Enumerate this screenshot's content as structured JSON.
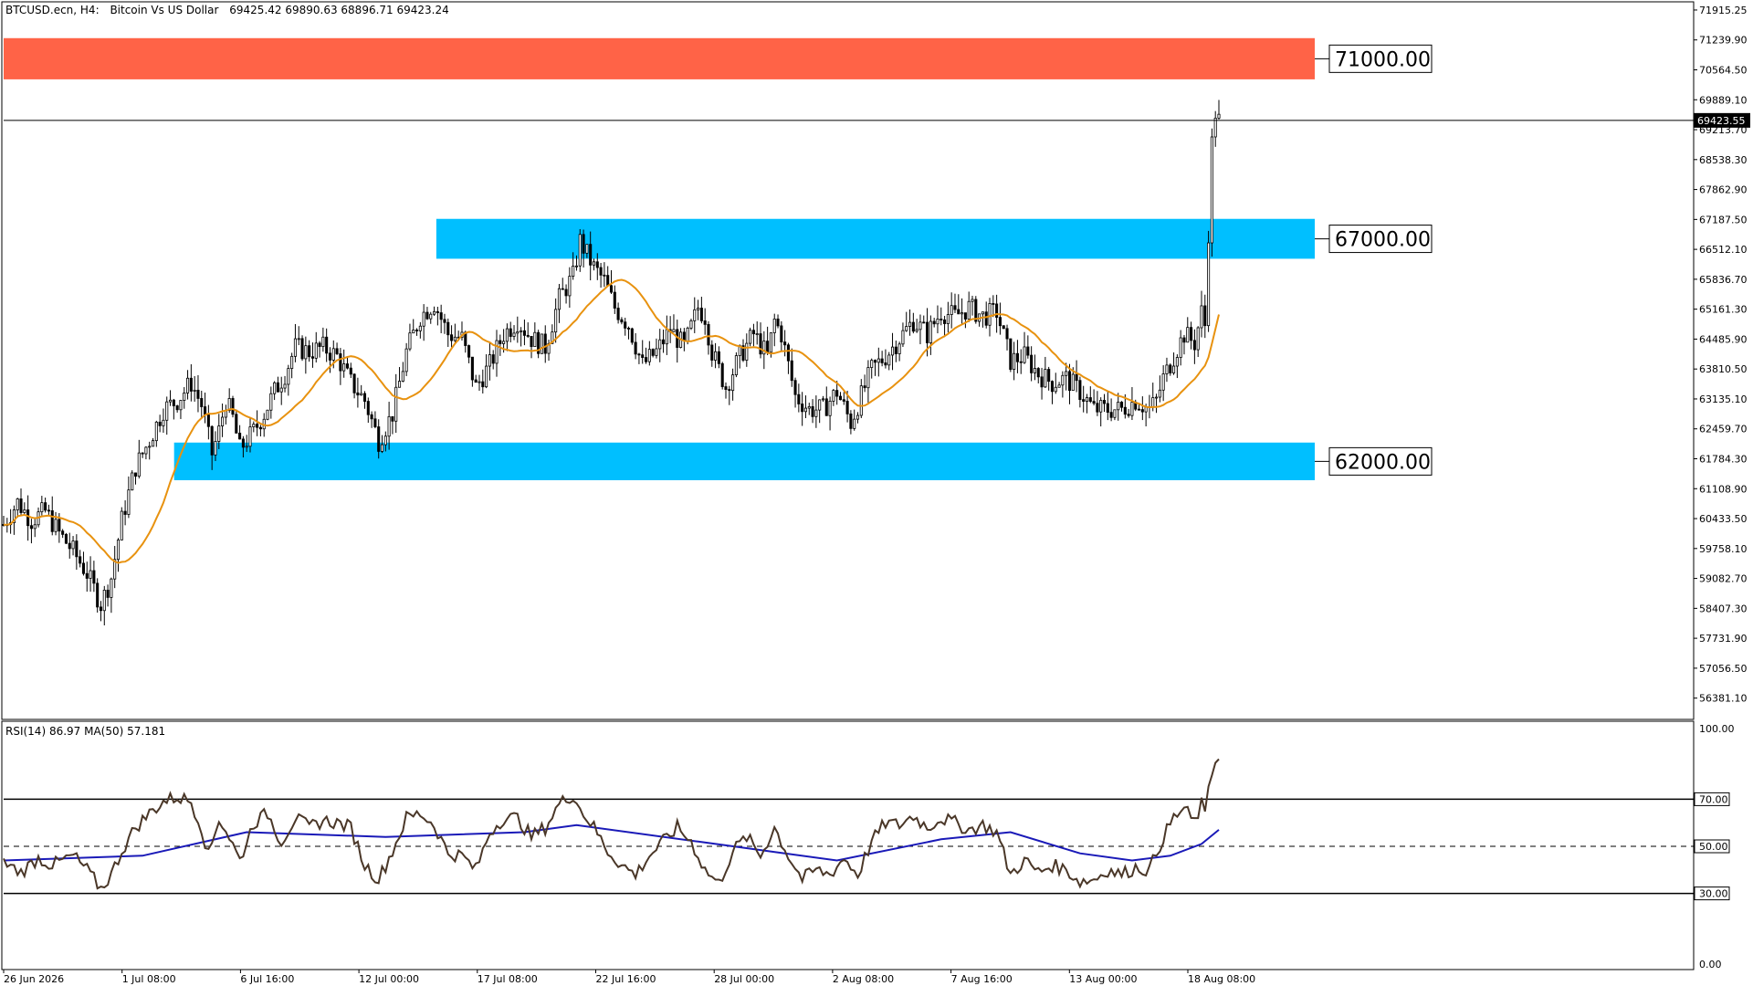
{
  "header": {
    "symbol": "BTCUSD.ecn, H4:",
    "description": "Bitcoin Vs US Dollar",
    "ohlc": "69425.42 69890.63 68896.71 69423.24"
  },
  "colors": {
    "bull": "#000000",
    "bear": "#000000",
    "ma": "#E8920F",
    "resistance_zone": "#FF6347",
    "support_zone": "#00BFFF",
    "rsi_line": "#4A3728",
    "rsi_ma": "#1A1AB8"
  },
  "chart_data": [
    {
      "type": "candlestick",
      "timeframe": "H4",
      "ylim": [
        55900,
        72100
      ],
      "y_ticks": [
        "71915.25",
        "71239.90",
        "70564.50",
        "69889.10",
        "69213.70",
        "68538.30",
        "67862.90",
        "67187.50",
        "66512.10",
        "65836.70",
        "65161.30",
        "64485.90",
        "63810.50",
        "63135.10",
        "62459.70",
        "61784.30",
        "61108.90",
        "60433.50",
        "59758.10",
        "59082.70",
        "58407.30",
        "57731.90",
        "57056.50",
        "56381.10"
      ],
      "x_ticks": [
        "26 Jun 2026",
        "1 Jul 08:00",
        "6 Jul 16:00",
        "12 Jul 00:00",
        "17 Jul 08:00",
        "22 Jul 16:00",
        "28 Jul 00:00",
        "2 Aug 08:00",
        "7 Aug 16:00",
        "13 Aug 00:00",
        "18 Aug 08:00"
      ],
      "current_price": "69423.55",
      "zones": [
        {
          "label": "71000.00",
          "low": 70350,
          "high": 71280,
          "start": 0.0,
          "color": "resistance"
        },
        {
          "label": "67000.00",
          "low": 66300,
          "high": 67200,
          "start": 0.33,
          "color": "support"
        },
        {
          "label": "62000.00",
          "low": 61300,
          "high": 62150,
          "start": 0.13,
          "color": "support"
        }
      ],
      "close_path": [
        [
          0,
          60300
        ],
        [
          4,
          60800
        ],
        [
          8,
          60400
        ],
        [
          12,
          60600
        ],
        [
          16,
          60100
        ],
        [
          20,
          59700
        ],
        [
          24,
          59200
        ],
        [
          28,
          58500
        ],
        [
          31,
          59100
        ],
        [
          34,
          60400
        ],
        [
          38,
          61600
        ],
        [
          42,
          62200
        ],
        [
          46,
          62900
        ],
        [
          50,
          63100
        ],
        [
          54,
          63500
        ],
        [
          57,
          63000
        ],
        [
          60,
          61900
        ],
        [
          62,
          62400
        ],
        [
          64,
          63100
        ],
        [
          66,
          62700
        ],
        [
          68,
          62000
        ],
        [
          72,
          62400
        ],
        [
          75,
          62800
        ],
        [
          78,
          63300
        ],
        [
          81,
          63700
        ],
        [
          84,
          64300
        ],
        [
          88,
          64200
        ],
        [
          92,
          64300
        ],
        [
          96,
          64100
        ],
        [
          100,
          63500
        ],
        [
          104,
          63100
        ],
        [
          108,
          62200
        ],
        [
          112,
          62800
        ],
        [
          116,
          64200
        ],
        [
          120,
          65000
        ],
        [
          124,
          65300
        ],
        [
          128,
          64600
        ],
        [
          132,
          64500
        ],
        [
          136,
          63400
        ],
        [
          140,
          63900
        ],
        [
          144,
          64600
        ],
        [
          148,
          64900
        ],
        [
          152,
          64500
        ],
        [
          156,
          64300
        ],
        [
          160,
          65400
        ],
        [
          164,
          65900
        ],
        [
          166,
          66700
        ],
        [
          168,
          66400
        ],
        [
          170,
          66100
        ],
        [
          173,
          65800
        ],
        [
          176,
          65200
        ],
        [
          180,
          64800
        ],
        [
          184,
          63900
        ],
        [
          188,
          64200
        ],
        [
          192,
          64700
        ],
        [
          196,
          64300
        ],
        [
          200,
          65200
        ],
        [
          202,
          65000
        ],
        [
          204,
          64200
        ],
        [
          208,
          63400
        ],
        [
          212,
          64100
        ],
        [
          216,
          64600
        ],
        [
          220,
          64100
        ],
        [
          222,
          64900
        ],
        [
          224,
          64600
        ],
        [
          228,
          63200
        ],
        [
          232,
          62900
        ],
        [
          236,
          62900
        ],
        [
          240,
          63300
        ],
        [
          244,
          62600
        ],
        [
          246,
          63000
        ],
        [
          250,
          63800
        ],
        [
          254,
          64100
        ],
        [
          258,
          64500
        ],
        [
          262,
          64900
        ],
        [
          266,
          64600
        ],
        [
          270,
          65100
        ],
        [
          274,
          65000
        ],
        [
          278,
          65200
        ],
        [
          282,
          65000
        ],
        [
          286,
          65100
        ],
        [
          290,
          64000
        ],
        [
          294,
          64100
        ],
        [
          298,
          63700
        ],
        [
          302,
          63500
        ],
        [
          306,
          63600
        ],
        [
          310,
          63300
        ],
        [
          314,
          62900
        ],
        [
          318,
          62900
        ],
        [
          322,
          62900
        ],
        [
          326,
          63100
        ],
        [
          330,
          62900
        ],
        [
          332,
          63100
        ],
        [
          334,
          63600
        ],
        [
          337,
          64100
        ],
        [
          340,
          64600
        ],
        [
          343,
          64400
        ],
        [
          345,
          65100
        ],
        [
          346,
          64800
        ],
        [
          347,
          66900
        ],
        [
          348,
          68900
        ],
        [
          349,
          69600
        ],
        [
          350,
          69423
        ]
      ],
      "ma_period": 20
    },
    {
      "type": "line",
      "title": "RSI(14) 86.97 MA(50) 57.181",
      "ylim": [
        0,
        100
      ],
      "y_ticks": [
        "100.00",
        "70.00",
        "50.00",
        "30.00",
        "0.00"
      ],
      "levels": [
        70,
        50,
        30
      ],
      "series": [
        {
          "key": "rsi",
          "values": [
            [
              0,
              43
            ],
            [
              5,
              39
            ],
            [
              10,
              45
            ],
            [
              14,
              42
            ],
            [
              20,
              46
            ],
            [
              24,
              40
            ],
            [
              28,
              32
            ],
            [
              31,
              38
            ],
            [
              34,
              48
            ],
            [
              38,
              58
            ],
            [
              42,
              64
            ],
            [
              46,
              69
            ],
            [
              50,
              71
            ],
            [
              54,
              69
            ],
            [
              57,
              58
            ],
            [
              59,
              46
            ],
            [
              62,
              62
            ],
            [
              65,
              54
            ],
            [
              68,
              44
            ],
            [
              72,
              60
            ],
            [
              76,
              64
            ],
            [
              80,
              52
            ],
            [
              84,
              62
            ],
            [
              88,
              58
            ],
            [
              92,
              61
            ],
            [
              96,
              60
            ],
            [
              100,
              58
            ],
            [
              104,
              42
            ],
            [
              108,
              36
            ],
            [
              112,
              48
            ],
            [
              116,
              62
            ],
            [
              120,
              64
            ],
            [
              124,
              59
            ],
            [
              128,
              47
            ],
            [
              132,
              46
            ],
            [
              136,
              40
            ],
            [
              140,
              56
            ],
            [
              144,
              62
            ],
            [
              148,
              62
            ],
            [
              152,
              54
            ],
            [
              156,
              58
            ],
            [
              160,
              68
            ],
            [
              164,
              72
            ],
            [
              166,
              66
            ],
            [
              170,
              58
            ],
            [
              174,
              48
            ],
            [
              178,
              42
            ],
            [
              182,
              38
            ],
            [
              186,
              46
            ],
            [
              190,
              52
            ],
            [
              194,
              58
            ],
            [
              198,
              52
            ],
            [
              202,
              40
            ],
            [
              206,
              34
            ],
            [
              210,
              48
            ],
            [
              214,
              54
            ],
            [
              218,
              46
            ],
            [
              222,
              58
            ],
            [
              226,
              46
            ],
            [
              230,
              36
            ],
            [
              234,
              40
            ],
            [
              238,
              38
            ],
            [
              242,
              45
            ],
            [
              246,
              38
            ],
            [
              250,
              52
            ],
            [
              254,
              60
            ],
            [
              258,
              59
            ],
            [
              262,
              63
            ],
            [
              266,
              58
            ],
            [
              270,
              62
            ],
            [
              274,
              60
            ],
            [
              278,
              57
            ],
            [
              282,
              59
            ],
            [
              286,
              56
            ],
            [
              290,
              38
            ],
            [
              294,
              44
            ],
            [
              298,
              39
            ],
            [
              302,
              42
            ],
            [
              306,
              40
            ],
            [
              310,
              35
            ],
            [
              314,
              36
            ],
            [
              318,
              40
            ],
            [
              322,
              38
            ],
            [
              326,
              41
            ],
            [
              330,
              40
            ],
            [
              334,
              54
            ],
            [
              337,
              62
            ],
            [
              340,
              66
            ],
            [
              343,
              60
            ],
            [
              345,
              68
            ],
            [
              346,
              62
            ],
            [
              347,
              76
            ],
            [
              348,
              82
            ],
            [
              349,
              86
            ],
            [
              350,
              87
            ]
          ]
        },
        {
          "key": "rsi_ma",
          "values": [
            [
              0,
              44
            ],
            [
              40,
              46
            ],
            [
              70,
              56
            ],
            [
              110,
              54
            ],
            [
              150,
              56
            ],
            [
              165,
              59
            ],
            [
              200,
              52
            ],
            [
              225,
              47
            ],
            [
              240,
              44
            ],
            [
              270,
              53
            ],
            [
              290,
              56
            ],
            [
              310,
              47
            ],
            [
              325,
              44
            ],
            [
              336,
              46
            ],
            [
              345,
              51
            ],
            [
              350,
              57
            ]
          ]
        }
      ]
    }
  ]
}
